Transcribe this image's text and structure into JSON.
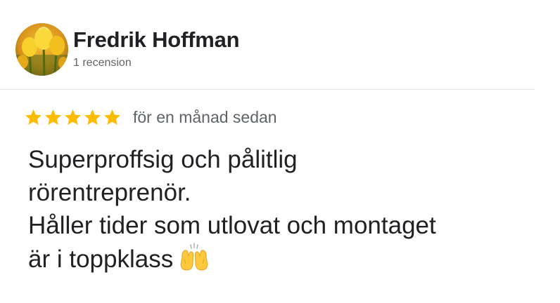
{
  "reviewer": {
    "name": "Fredrik Hoffman",
    "review_count": "1 recension",
    "avatar_icon": "tulip-photo-avatar"
  },
  "review": {
    "rating": 5,
    "max_rating": 5,
    "star_color": "#fbbc04",
    "date": "för en månad sedan",
    "text_lines": [
      "Superproffsig och pålitlig",
      "rörentreprenör.",
      "Håller tider som utlovat och montaget",
      "är i toppklass"
    ],
    "emoji_icon": "raising-hands-icon"
  }
}
